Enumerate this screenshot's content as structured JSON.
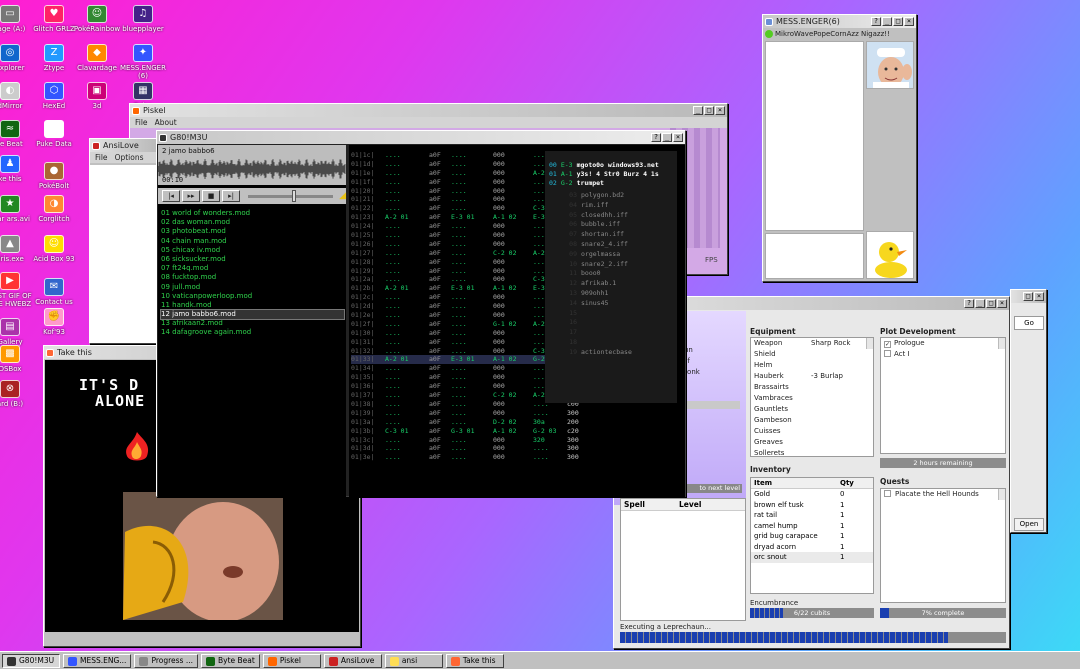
{
  "desktop": {
    "icons": [
      {
        "label": "rage (A:)",
        "icon": "floppy-icon",
        "color": "#777777",
        "glyph": "▭"
      },
      {
        "label": "Glitch GRLZ",
        "icon": "heart-icon",
        "color": "#ff2266",
        "glyph": "♥"
      },
      {
        "label": "PokéRainbow",
        "icon": "pixel-people-icon",
        "color": "#338833",
        "glyph": "☺"
      },
      {
        "label": "bluepplayer",
        "icon": "music-icon",
        "color": "#442288",
        "glyph": "♫"
      },
      {
        "label": "Explorer",
        "icon": "globe-icon",
        "color": "#1166cc",
        "glyph": "◎"
      },
      {
        "label": "Ztype",
        "icon": "z-icon",
        "color": "#2299ff",
        "glyph": "Z"
      },
      {
        "label": "Clavardage",
        "icon": "chat-icon",
        "color": "#ff8800",
        "glyph": "◆"
      },
      {
        "label": "MESS.ENGER (6)",
        "icon": "butterfly-icon",
        "color": "#3355ff",
        "glyph": "✦"
      },
      {
        "label": "dMirror",
        "icon": "mirror-icon",
        "color": "#cccccc",
        "glyph": "◐"
      },
      {
        "label": "HexEd",
        "icon": "hex-icon",
        "color": "#3355ff",
        "glyph": "⬡"
      },
      {
        "label": "3d",
        "icon": "cube-icon",
        "color": "#cc0077",
        "glyph": "▣"
      },
      {
        "label": "Pulse",
        "icon": "keyboard-icon",
        "color": "#333366",
        "glyph": "▦"
      },
      {
        "label": "te Beat",
        "icon": "waveform-icon",
        "color": "#116611",
        "glyph": "≈"
      },
      {
        "label": "Puke Data",
        "icon": "pd-icon",
        "color": "#ffffff",
        "glyph": "Pd"
      },
      {
        "label": "ke this",
        "icon": "penguin-icon",
        "color": "#2266ff",
        "glyph": "♟"
      },
      {
        "label": "PokéBolt",
        "icon": "cookie-icon",
        "color": "#aa6633",
        "glyph": "●"
      },
      {
        "label": "Star ars.avi",
        "icon": "star-icon",
        "color": "#228822",
        "glyph": "★"
      },
      {
        "label": "Corglitch",
        "icon": "dog-icon",
        "color": "#ff8833",
        "glyph": "◑"
      },
      {
        "label": "dris.exe",
        "icon": "bird-icon",
        "color": "#888888",
        "glyph": "▲"
      },
      {
        "label": "Acid Box 93",
        "icon": "smiley-icon",
        "color": "#ffdd00",
        "glyph": "☺"
      },
      {
        "label": "BEST GIF OF THE HWEBZ",
        "icon": "gif-icon",
        "color": "#ff3333",
        "glyph": "▶"
      },
      {
        "label": "Contact us",
        "icon": "mail-icon",
        "color": "#3366cc",
        "glyph": "✉"
      },
      {
        "label": "Gallery",
        "icon": "gallery-icon",
        "color": "#aa33aa",
        "glyph": "▤"
      },
      {
        "label": "Kof'93",
        "icon": "fighter-icon",
        "color": "#ff99cc",
        "glyph": "✊"
      },
      {
        "label": "DSBox",
        "icon": "box-icon",
        "color": "#ff9900",
        "glyph": "▩"
      },
      {
        "label": "ard (B:)",
        "icon": "drive-icon",
        "color": "#aa2222",
        "glyph": "⊗"
      }
    ]
  },
  "messenger": {
    "title": "MESS.ENGER(6)",
    "contact": "MikroWavePopeCornAzz Nigazz!!"
  },
  "piskel": {
    "title": "Piskel",
    "menu": [
      "File",
      "About"
    ],
    "fps": "FPS"
  },
  "ansilove": {
    "title": "AnsiLove",
    "menu": [
      "File",
      "Options"
    ]
  },
  "takethis": {
    "title": "Take this",
    "text1": "IT'S D",
    "text2": "ALONE"
  },
  "player": {
    "title": "G80!M3U",
    "track": "2 jamo babbo6",
    "time": "00:10",
    "controls": [
      {
        "icon": "prev-icon",
        "g": "|◂"
      },
      {
        "icon": "rewind-icon",
        "g": "▸▸"
      },
      {
        "icon": "stop-icon",
        "g": "■"
      },
      {
        "icon": "next-icon",
        "g": "▸|"
      }
    ],
    "playlist": [
      "01 world of wonders.mod",
      "02 das woman.mod",
      "03 photobeat.mod",
      "04 chain man.mod",
      "05 chicax iv.mod",
      "06 sicksucker.mod",
      "07 ft24q.mod",
      "08 fucktop.mod",
      "09 jull.mod",
      "10 vaticanpowerloop.mod",
      "11 handk.mod",
      "12 jamo babbo6.mod",
      "13 afrikaan2.mod",
      "14 dafagroove again.mod"
    ],
    "selected": 11,
    "tracker": {
      "rows": [
        {
          "n": "01|1c|",
          "a": "",
          "b": "a0F",
          "c": "",
          "d": "000",
          "e": "",
          "f": "300"
        },
        {
          "n": "01|1d|",
          "a": "",
          "b": "a0F",
          "c": "",
          "d": "000",
          "e": "",
          "f": "300"
        },
        {
          "n": "01|1e|",
          "a": "",
          "b": "a0F",
          "c": "",
          "d": "000",
          "e": "A-2 03",
          "f": "c10"
        },
        {
          "n": "01|1f|",
          "a": "",
          "b": "a0F",
          "c": "",
          "d": "000",
          "e": "",
          "f": "c00"
        },
        {
          "n": "01|20|",
          "a": "",
          "b": "a0F",
          "c": "",
          "d": "000",
          "e": "",
          "f": "602"
        },
        {
          "n": "01|21|",
          "a": "",
          "b": "a0F",
          "c": "",
          "d": "000",
          "e": "",
          "f": "603"
        },
        {
          "n": "01|22|",
          "a": "",
          "b": "a0F",
          "c": "",
          "d": "000",
          "e": "C-3 03",
          "f": "c10"
        },
        {
          "n": "01|23|",
          "a": "A-2 01",
          "b": "a0F",
          "c": "E-3 01",
          "d": "A-1 02",
          "e": "E-3 03",
          "f": "c20"
        },
        {
          "n": "01|24|",
          "a": "",
          "b": "a0F",
          "c": "",
          "d": "000",
          "e": "",
          "f": "c00"
        },
        {
          "n": "01|25|",
          "a": "",
          "b": "a0F",
          "c": "",
          "d": "000",
          "e": "",
          "f": "c00"
        },
        {
          "n": "01|26|",
          "a": "",
          "b": "a0F",
          "c": "",
          "d": "000",
          "e": "",
          "f": "300"
        },
        {
          "n": "01|27|",
          "a": "",
          "b": "a0F",
          "c": "",
          "d": "C-2 02",
          "e": "A-2 03",
          "f": "c20"
        },
        {
          "n": "01|28|",
          "a": "",
          "b": "a0F",
          "c": "",
          "d": "000",
          "e": "",
          "f": "602"
        },
        {
          "n": "01|29|",
          "a": "",
          "b": "a0F",
          "c": "",
          "d": "000",
          "e": "",
          "f": "603"
        },
        {
          "n": "01|2a|",
          "a": "",
          "b": "a0F",
          "c": "",
          "d": "000",
          "e": "C-3 03",
          "f": "c20"
        },
        {
          "n": "01|2b|",
          "a": "A-2 01",
          "b": "a0F",
          "c": "E-3 01",
          "d": "A-1 02",
          "e": "E-3 03",
          "f": "310"
        },
        {
          "n": "01|2c|",
          "a": "",
          "b": "a0F",
          "c": "",
          "d": "000",
          "e": "",
          "f": "c00"
        },
        {
          "n": "01|2d|",
          "a": "",
          "b": "a0F",
          "c": "",
          "d": "000",
          "e": "",
          "f": "c00"
        },
        {
          "n": "01|2e|",
          "a": "",
          "b": "a0F",
          "c": "",
          "d": "000",
          "e": "",
          "f": "300"
        },
        {
          "n": "01|2f|",
          "a": "",
          "b": "a0F",
          "c": "",
          "d": "G-1 02",
          "e": "A-2 03",
          "f": "c20"
        },
        {
          "n": "01|30|",
          "a": "",
          "b": "a0F",
          "c": "",
          "d": "000",
          "e": "",
          "f": "c00"
        },
        {
          "n": "01|31|",
          "a": "",
          "b": "a0F",
          "c": "",
          "d": "000",
          "e": "",
          "f": "c00"
        },
        {
          "n": "01|32|",
          "a": "",
          "b": "a0F",
          "c": "",
          "d": "000",
          "e": "C-3 03",
          "f": "c20"
        },
        {
          "n": "01|33|",
          "a": "A-2 01",
          "b": "a0F",
          "c": "E-3 01",
          "d": "A-1 02",
          "e": "G-2 03",
          "f": "30d"
        },
        {
          "n": "01|34|",
          "a": "",
          "b": "a0F",
          "c": "",
          "d": "000",
          "e": "",
          "f": "300"
        },
        {
          "n": "01|35|",
          "a": "",
          "b": "a0F",
          "c": "",
          "d": "000",
          "e": "",
          "f": "300"
        },
        {
          "n": "01|36|",
          "a": "",
          "b": "a0F",
          "c": "",
          "d": "000",
          "e": "",
          "f": "c00"
        },
        {
          "n": "01|37|",
          "a": "",
          "b": "a0F",
          "c": "",
          "d": "C-2 02",
          "e": "A-2 03",
          "f": "c20"
        },
        {
          "n": "01|38|",
          "a": "",
          "b": "a0F",
          "c": "",
          "d": "000",
          "e": "",
          "f": "c00"
        },
        {
          "n": "01|39|",
          "a": "",
          "b": "a0F",
          "c": "",
          "d": "000",
          "e": "",
          "f": "300"
        },
        {
          "n": "01|3a|",
          "a": "",
          "b": "a0F",
          "c": "",
          "d": "D-2 02",
          "e": "30a",
          "f": "200"
        },
        {
          "n": "01|3b|",
          "a": "C-3 01",
          "b": "a0F",
          "c": "G-3 01",
          "d": "A-1 02",
          "e": "G-2 03",
          "f": "c20"
        },
        {
          "n": "01|3c|",
          "a": "",
          "b": "a0F",
          "c": "",
          "d": "000",
          "e": "320",
          "f": "300"
        },
        {
          "n": "01|3d|",
          "a": "",
          "b": "a0F",
          "c": "",
          "d": "000",
          "e": "",
          "f": "300"
        },
        {
          "n": "01|3e|",
          "a": "",
          "b": "a0F",
          "c": "",
          "d": "000",
          "e": "",
          "f": "300"
        }
      ],
      "highlight": 23,
      "samples_head": [
        {
          "id": "00",
          "note": "E-3",
          "text": "mgoto0o windows93.net"
        },
        {
          "id": "01",
          "note": "A-1",
          "text": "y3s! 4 Str0 Burz 4 1s"
        },
        {
          "id": "02",
          "note": "G-2",
          "text": "trumpet"
        }
      ],
      "samples": [
        "polygon.bd2",
        "rim.iff",
        "closedhh.iff",
        "bubble.iff",
        "shortan.iff",
        "snare2_4.iff",
        "orgelmassa",
        "snare2_2.iff",
        "booo0",
        "afrikab.1",
        "909ohh1",
        "sinus45",
        "",
        "",
        "",
        "",
        "actiontecbase"
      ]
    }
  },
  "rpg": {
    "equipment_title": "Equipment",
    "equipment": [
      {
        "slot": "Weapon",
        "item": "Sharp Rock"
      },
      {
        "slot": "Shield",
        "item": ""
      },
      {
        "slot": "Helm",
        "item": ""
      },
      {
        "slot": "Hauberk",
        "item": "-3 Burlap"
      },
      {
        "slot": "Brassairts",
        "item": ""
      },
      {
        "slot": "Vambraces",
        "item": ""
      },
      {
        "slot": "Gauntlets",
        "item": ""
      },
      {
        "slot": "Gambeson",
        "item": ""
      },
      {
        "slot": "Cuisses",
        "item": ""
      },
      {
        "slot": "Greaves",
        "item": ""
      },
      {
        "slot": "Sollerets",
        "item": ""
      }
    ],
    "plot_title": "Plot Development",
    "plot": [
      "Prologue",
      "Act I"
    ],
    "plot_status": "2 hours remaining",
    "left_stub": [
      "run",
      "Elf",
      "Monk"
    ],
    "next_level": "to next level",
    "spell_col": "Spell",
    "level_col": "Level",
    "inventory_title": "Inventory",
    "item_col": "Item",
    "qty_col": "Qty",
    "inventory": [
      {
        "item": "Gold",
        "qty": "0"
      },
      {
        "item": "brown elf tusk",
        "qty": "1"
      },
      {
        "item": "rat tail",
        "qty": "1"
      },
      {
        "item": "camel hump",
        "qty": "1"
      },
      {
        "item": "grid bug carapace",
        "qty": "1"
      },
      {
        "item": "dryad acorn",
        "qty": "1"
      },
      {
        "item": "orc snout",
        "qty": "1"
      }
    ],
    "encumbrance": "Encumbrance",
    "enc_value": "6/22 cubits",
    "enc_progress": 0.27,
    "quests_title": "Quests",
    "quest": "Placate the Hell Hounds",
    "quest_value": "7% complete",
    "quest_progress": 0.07,
    "status": "Executing a Leprechaun...",
    "exec_progress": 0.85,
    "go": "Go",
    "open": "Open"
  },
  "taskbar": [
    {
      "label": "G80!M3U",
      "color": "#333333",
      "on": true
    },
    {
      "label": "MESS.ENG...",
      "color": "#3355ff",
      "on": false
    },
    {
      "label": "Progress ...",
      "color": "#888888",
      "on": false
    },
    {
      "label": "Byte Beat",
      "color": "#116611",
      "on": false
    },
    {
      "label": "Piskel",
      "color": "#ff6600",
      "on": false
    },
    {
      "label": "AnsiLove",
      "color": "#cc2222",
      "on": false
    },
    {
      "label": "ansi",
      "color": "#ffdd55",
      "on": false
    },
    {
      "label": "Take this",
      "color": "#ff6633",
      "on": false
    }
  ]
}
